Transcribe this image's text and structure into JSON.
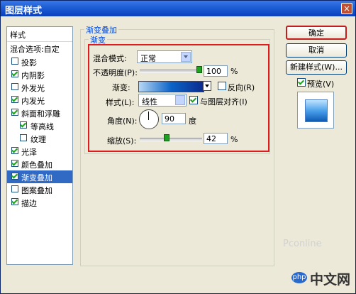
{
  "window": {
    "title": "图层样式",
    "close_label": "×"
  },
  "left_panel": {
    "header": "样式",
    "items": [
      {
        "label": "混合选项:自定",
        "checked": null
      },
      {
        "label": "投影",
        "checked": false
      },
      {
        "label": "内阴影",
        "checked": true
      },
      {
        "label": "外发光",
        "checked": false
      },
      {
        "label": "内发光",
        "checked": true
      },
      {
        "label": "斜面和浮雕",
        "checked": true
      },
      {
        "label": "等高线",
        "checked": true,
        "indent": true
      },
      {
        "label": "纹理",
        "checked": false,
        "indent": true
      },
      {
        "label": "光泽",
        "checked": true
      },
      {
        "label": "颜色叠加",
        "checked": true
      },
      {
        "label": "渐变叠加",
        "checked": true,
        "selected": true
      },
      {
        "label": "图案叠加",
        "checked": false
      },
      {
        "label": "描边",
        "checked": true
      }
    ]
  },
  "main": {
    "group_outer_title": "渐变叠加",
    "group_inner_title": "渐变",
    "blend_mode": {
      "label": "混合模式:",
      "value": "正常"
    },
    "opacity": {
      "label": "不透明度(P):",
      "value": "100",
      "unit": "%",
      "level": 1.0
    },
    "gradient": {
      "label": "渐变:",
      "reverse_label": "反向(R)",
      "reverse_checked": false
    },
    "style": {
      "label": "样式(L):",
      "value": "线性",
      "align_label": "与图层对齐(I)",
      "align_checked": true
    },
    "angle": {
      "label": "角度(N):",
      "value": "90",
      "unit": "度"
    },
    "scale": {
      "label": "缩放(S):",
      "value": "42",
      "unit": "%",
      "level": 0.42
    }
  },
  "buttons": {
    "ok": "确定",
    "cancel": "取消",
    "new_style": "新建样式(W)...",
    "preview_label": "预览(V)",
    "preview_checked": true
  },
  "watermark": {
    "text": "Pconline",
    "site_text": "中文网",
    "logo_text": "php"
  }
}
